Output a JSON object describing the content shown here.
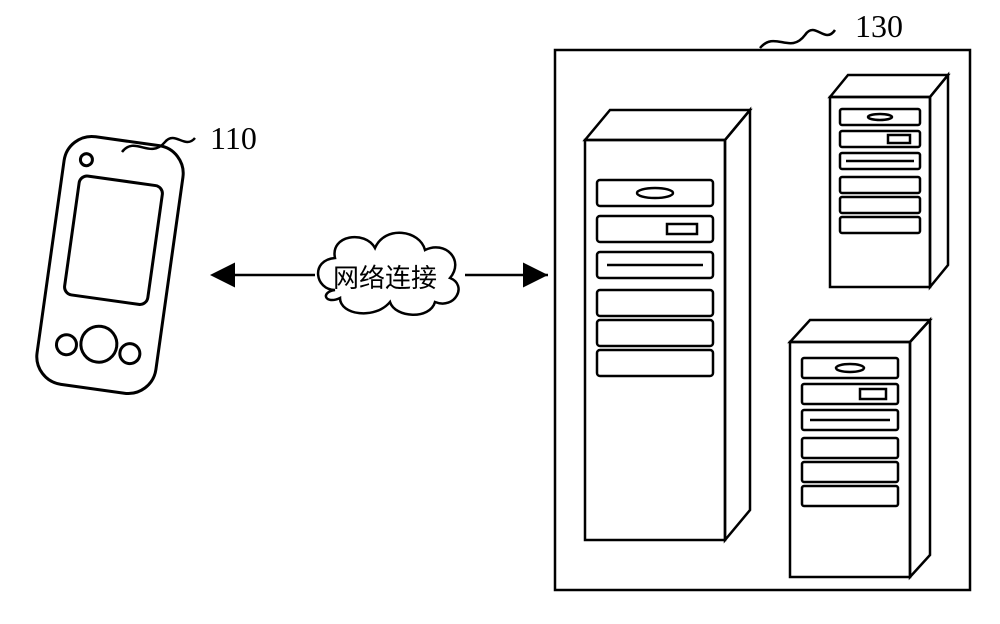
{
  "labels": {
    "device": "110",
    "servers": "130",
    "connection": "网络连接"
  }
}
